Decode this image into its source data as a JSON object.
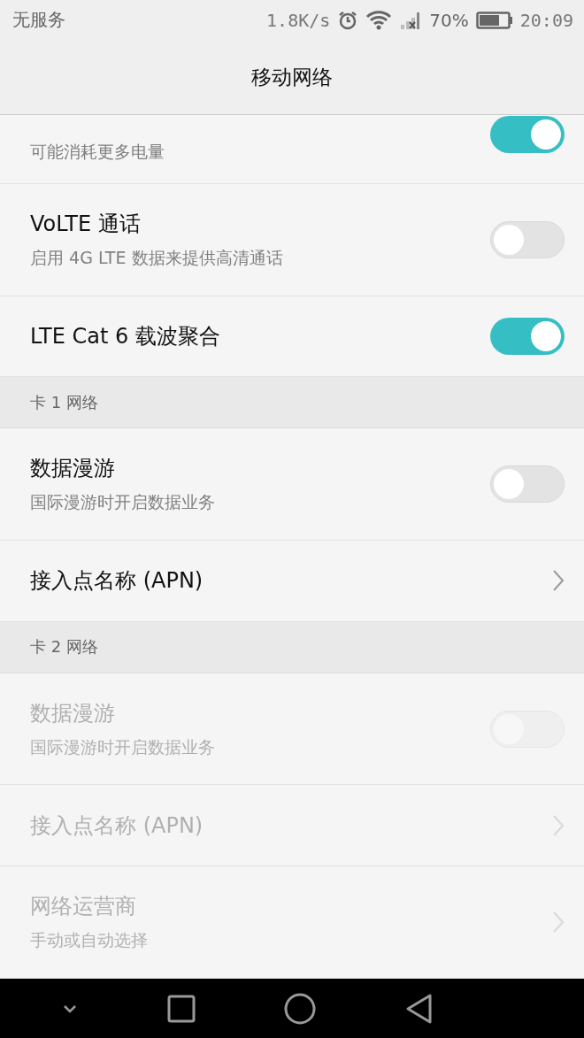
{
  "status_bar": {
    "carrier": "无服务",
    "speed": "1.8K/s",
    "battery_percent": "70%",
    "time": "20:09"
  },
  "title": "移动网络",
  "items": [
    {
      "kind": "toggle",
      "subtitle": "可能消耗更多电量",
      "on": true,
      "disabled": false,
      "cut": true
    },
    {
      "kind": "toggle",
      "title": "VoLTE 通话",
      "subtitle": "启用 4G LTE 数据来提供高清通话",
      "on": false,
      "disabled": false
    },
    {
      "kind": "toggle",
      "title": "LTE Cat 6 载波聚合",
      "on": true,
      "disabled": false
    },
    {
      "kind": "section",
      "title": "卡 1 网络"
    },
    {
      "kind": "toggle",
      "title": "数据漫游",
      "subtitle": "国际漫游时开启数据业务",
      "on": false,
      "disabled": false
    },
    {
      "kind": "link",
      "title": "接入点名称 (APN)",
      "disabled": false
    },
    {
      "kind": "section",
      "title": "卡 2 网络"
    },
    {
      "kind": "toggle",
      "title": "数据漫游",
      "subtitle": "国际漫游时开启数据业务",
      "on": false,
      "disabled": true
    },
    {
      "kind": "link",
      "title": "接入点名称 (APN)",
      "disabled": true
    },
    {
      "kind": "link",
      "title": "网络运营商",
      "subtitle": "手动或自动选择",
      "disabled": true
    }
  ]
}
